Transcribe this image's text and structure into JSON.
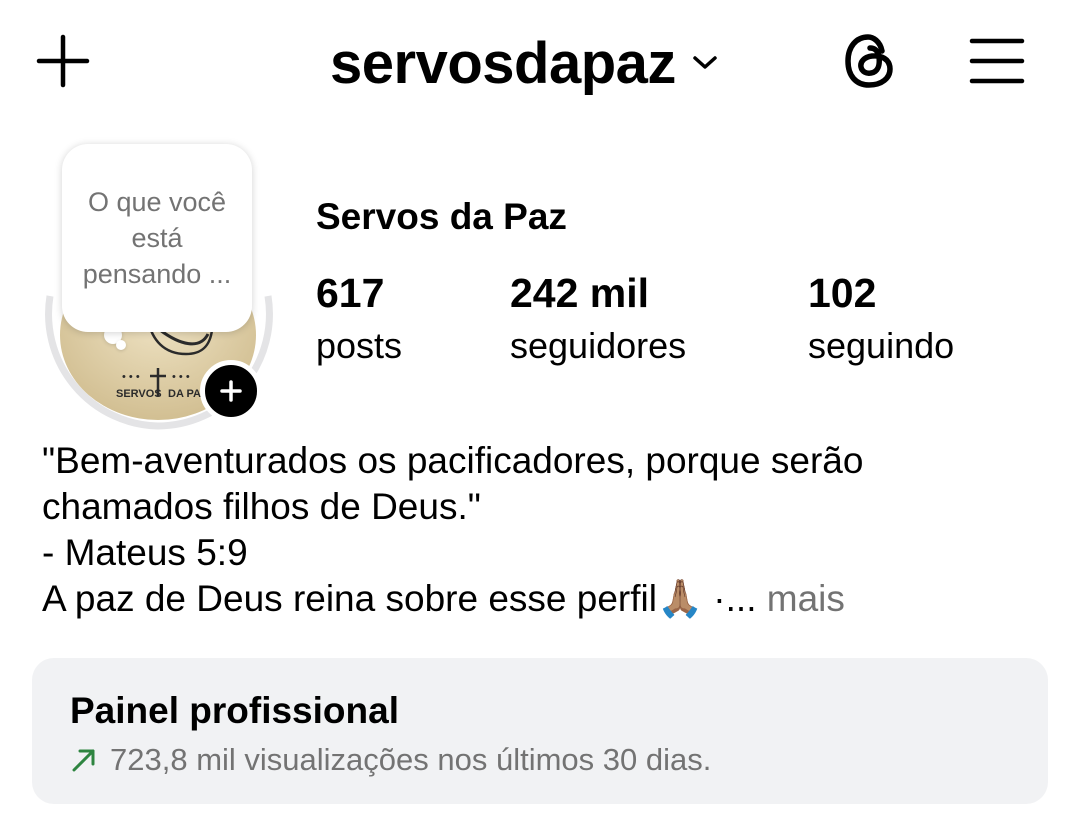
{
  "header": {
    "username": "servosdapaz"
  },
  "profile": {
    "display_name": "Servos da Paz",
    "note_text": "O que você está pensando ...",
    "avatar_caption_left": "SERVOS",
    "avatar_caption_right": "DA PAZ"
  },
  "stats": [
    {
      "value": "617",
      "label": "posts"
    },
    {
      "value": "242 mil",
      "label": "seguidores"
    },
    {
      "value": "102",
      "label": "seguindo"
    }
  ],
  "bio": {
    "line1": "\"Bem-aventurados os pacificadores, porque serão",
    "line2": "chamados filhos de Deus.\"",
    "line3": "- Mateus 5:9",
    "line4": "A paz de Deus reina sobre esse perfil🙏🏽 ·...",
    "more": "mais"
  },
  "panel": {
    "title": "Painel profissional",
    "subtitle": "723,8 mil visualizações nos últimos 30 dias.",
    "trend_color": "#2e8540"
  },
  "icons": {
    "create": "plus-icon",
    "account_switch": "chevron-down-icon",
    "threads": "threads-icon",
    "menu": "hamburger-menu-icon",
    "add_story": "plus-icon",
    "trend": "trend-up-arrow-icon"
  }
}
